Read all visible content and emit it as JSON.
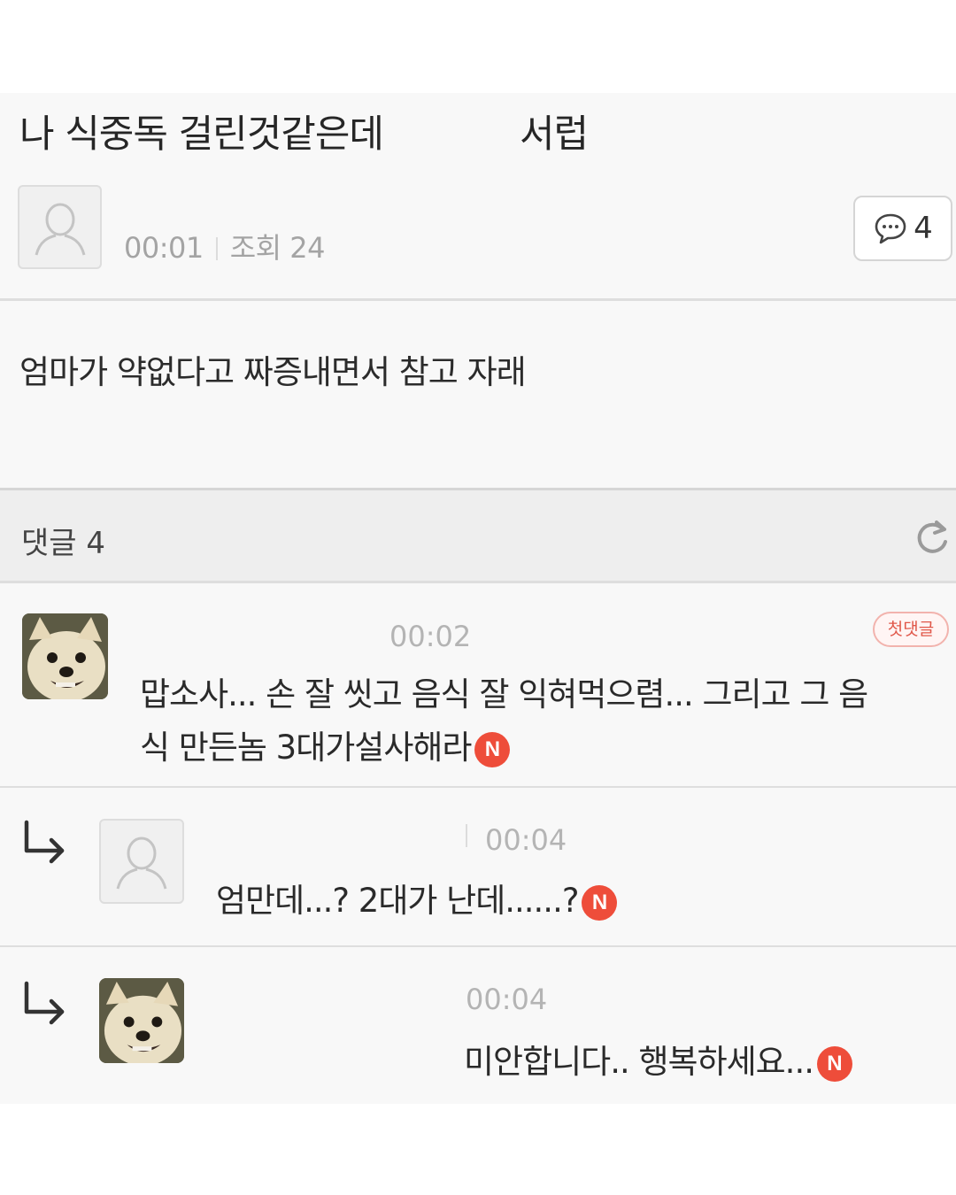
{
  "post": {
    "title": "나 식중독 걸린것같은데",
    "title_suffix": "서럽",
    "time": "00:01",
    "views": "조회 24",
    "comment_count": "4",
    "body": "엄마가 약없다고 짜증내면서 참고 자래"
  },
  "comments_section": {
    "label": "댓글 4"
  },
  "comments": [
    {
      "time": "00:02",
      "badge": "첫댓글",
      "text_line1": "맙소사... 손 잘 씻고 음식 잘 익혀먹으렴... 그리고 그 음",
      "text_line2": "식 만든놈 3대가설사해라",
      "new_mark": "N"
    },
    {
      "time": "00:04",
      "text": "엄만데...? 2대가 난데......?",
      "new_mark": "N"
    },
    {
      "time": "00:04",
      "text": "미안합니다.. 행복하세요...",
      "new_mark": "N"
    }
  ],
  "colors": {
    "new_badge": "#ee4d3a",
    "first_comment_badge": "#e0584a",
    "meta_text": "#a4a4a4"
  },
  "icons": [
    "default-avatar-icon",
    "comment-bubble-icon",
    "refresh-icon",
    "reply-arrow-icon",
    "dog-avatar"
  ]
}
